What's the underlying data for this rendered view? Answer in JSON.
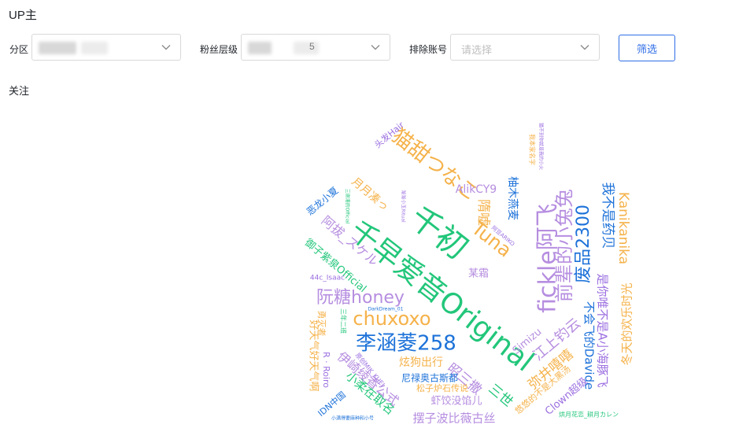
{
  "page": {
    "title": "UP主"
  },
  "filters": {
    "zone": {
      "label": "分区",
      "value": ""
    },
    "fan_tier": {
      "label": "粉丝层级",
      "value": "5"
    },
    "exclude": {
      "label": "排除账号",
      "placeholder": "请选择"
    },
    "submit_label": "筛选"
  },
  "section": {
    "label": "关注"
  },
  "wordcloud": {
    "palette": {
      "green": "#22c67a",
      "blue": "#1d72d9",
      "orange": "#f5b24a",
      "purple": "#b68ee0",
      "violet": "#9b6fe0",
      "gold": "#f2b83a"
    },
    "words": [
      {
        "text": "千初",
        "color": "green"
      },
      {
        "text": "千早爱音Original",
        "color": "green"
      },
      {
        "text": "fickle阿飞",
        "color": "purple"
      },
      {
        "text": "chuxoxo",
        "color": "orange"
      },
      {
        "text": "李涵菱258",
        "color": "blue"
      },
      {
        "text": "阮糖honey",
        "color": "purple"
      },
      {
        "text": "猫甜つなこ",
        "color": "orange"
      },
      {
        "text": "Tuna",
        "color": "orange"
      },
      {
        "text": "前辈的小兔兔",
        "color": "purple"
      },
      {
        "text": "废品2300",
        "color": "blue"
      },
      {
        "text": "我不是药贝",
        "color": "blue"
      },
      {
        "text": "Kanikanika",
        "color": "orange"
      },
      {
        "text": "是你唯不是A小海豚飞",
        "color": "violet"
      },
      {
        "text": "冬天的欢乐时光",
        "color": "orange"
      },
      {
        "text": "不会飞的Davide",
        "color": "blue"
      },
      {
        "text": "江上钓云",
        "color": "purple"
      },
      {
        "text": "弥井嘻嘻",
        "color": "orange"
      },
      {
        "text": "昭三撒",
        "color": "purple"
      },
      {
        "text": "三世",
        "color": "green"
      },
      {
        "text": "炫狗出行",
        "color": "orange"
      },
      {
        "text": "尼禄奥古斯都",
        "color": "blue"
      },
      {
        "text": "虾饺没馅儿",
        "color": "purple"
      },
      {
        "text": "摆子波比薇古丝",
        "color": "purple"
      },
      {
        "text": "松子炉石传说",
        "color": "orange"
      },
      {
        "text": "小柔在取名",
        "color": "green"
      },
      {
        "text": "伊崎绫香公式",
        "color": "purple"
      },
      {
        "text": "好天气好天气啊",
        "color": "orange"
      },
      {
        "text": "AlikCY9",
        "color": "purple"
      },
      {
        "text": "隋嘘",
        "color": "orange"
      },
      {
        "text": "某霜",
        "color": "purple"
      },
      {
        "text": "柚木燕麦",
        "color": "blue"
      },
      {
        "text": "阿拔_スケル",
        "color": "purple"
      },
      {
        "text": "月月凑っ",
        "color": "orange"
      },
      {
        "text": "御子紫泉Official",
        "color": "green"
      },
      {
        "text": "恶龙小夏",
        "color": "blue"
      },
      {
        "text": "头发Hair",
        "color": "violet"
      },
      {
        "text": "44c_Isaac",
        "color": "violet"
      },
      {
        "text": "Simizu",
        "color": "purple"
      },
      {
        "text": "Clown超级",
        "color": "violet"
      },
      {
        "text": "悠悠的不是大黑汤",
        "color": "orange"
      },
      {
        "text": "烘月花恋_耕月カレン",
        "color": "green"
      },
      {
        "text": "勇灭者",
        "color": "orange"
      },
      {
        "text": "R · Roiro",
        "color": "violet"
      },
      {
        "text": "IDN中国",
        "color": "blue"
      },
      {
        "text": "原创MIK_KUEI",
        "color": "violet"
      },
      {
        "text": "三年二班",
        "color": "green"
      },
      {
        "text": "三谢湘的Official",
        "color": "green"
      },
      {
        "text": "渐渐小玉Ritual",
        "color": "violet"
      },
      {
        "text": "阿豆ARIKO",
        "color": "violet"
      },
      {
        "text": "我本家名字",
        "color": "orange"
      },
      {
        "text": "小满得要麻种和小号",
        "color": "blue"
      },
      {
        "text": "DarkDream_01",
        "color": "blue"
      },
      {
        "text": "猫不到你就是我的小火",
        "color": "violet"
      }
    ]
  }
}
